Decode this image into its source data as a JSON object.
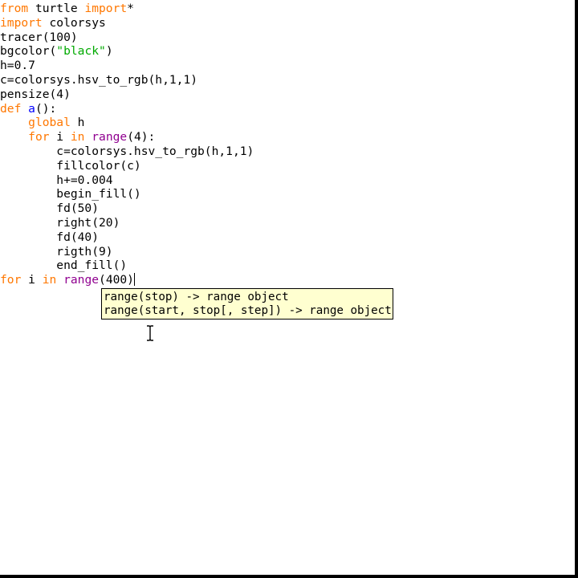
{
  "editor": {
    "lines": [
      [
        {
          "t": "from",
          "c": "kw"
        },
        {
          "t": " turtle ",
          "c": ""
        },
        {
          "t": "import",
          "c": "kw"
        },
        {
          "t": "*",
          "c": ""
        }
      ],
      [
        {
          "t": "import",
          "c": "kw"
        },
        {
          "t": " colorsys",
          "c": ""
        }
      ],
      [
        {
          "t": "tracer(100)",
          "c": ""
        }
      ],
      [
        {
          "t": "bgcolor(",
          "c": ""
        },
        {
          "t": "\"black\"",
          "c": "str"
        },
        {
          "t": ")",
          "c": ""
        }
      ],
      [
        {
          "t": "h=0.7",
          "c": ""
        }
      ],
      [
        {
          "t": "c=colorsys.hsv_to_rgb(h,1,1)",
          "c": ""
        }
      ],
      [
        {
          "t": "pensize(4)",
          "c": ""
        }
      ],
      [
        {
          "t": "def",
          "c": "kw"
        },
        {
          "t": " ",
          "c": ""
        },
        {
          "t": "a",
          "c": "fn"
        },
        {
          "t": "():",
          "c": ""
        }
      ],
      [
        {
          "t": "    ",
          "c": ""
        },
        {
          "t": "global",
          "c": "kw"
        },
        {
          "t": " h",
          "c": ""
        }
      ],
      [
        {
          "t": "    ",
          "c": ""
        },
        {
          "t": "for",
          "c": "kw"
        },
        {
          "t": " i ",
          "c": ""
        },
        {
          "t": "in",
          "c": "kw"
        },
        {
          "t": " ",
          "c": ""
        },
        {
          "t": "range",
          "c": "bi"
        },
        {
          "t": "(4):",
          "c": ""
        }
      ],
      [
        {
          "t": "        c=colorsys.hsv_to_rgb(h,1,1)",
          "c": ""
        }
      ],
      [
        {
          "t": "        fillcolor(c)",
          "c": ""
        }
      ],
      [
        {
          "t": "        h+=0.004",
          "c": ""
        }
      ],
      [
        {
          "t": "        begin_fill()",
          "c": ""
        }
      ],
      [
        {
          "t": "        fd(50)",
          "c": ""
        }
      ],
      [
        {
          "t": "        right(20)",
          "c": ""
        }
      ],
      [
        {
          "t": "        fd(40)",
          "c": ""
        }
      ],
      [
        {
          "t": "        rigth(9)",
          "c": ""
        }
      ],
      [
        {
          "t": "        end_fill()",
          "c": ""
        }
      ],
      [
        {
          "t": "for",
          "c": "kw"
        },
        {
          "t": " i ",
          "c": ""
        },
        {
          "t": "in",
          "c": "kw"
        },
        {
          "t": " ",
          "c": ""
        },
        {
          "t": "range",
          "c": "bi"
        },
        {
          "t": "(400)",
          "c": ""
        }
      ]
    ],
    "caret_line": 19
  },
  "calltip": {
    "lines": [
      "range(stop) -> range object",
      "range(start, stop[, step]) -> range object"
    ]
  },
  "colors": {
    "keyword": "#ff7700",
    "builtin": "#900090",
    "string": "#00aa00",
    "definition": "#0000ff",
    "calltip_bg": "#ffffd0"
  },
  "pointer": {
    "icon": "text-cursor-icon"
  }
}
